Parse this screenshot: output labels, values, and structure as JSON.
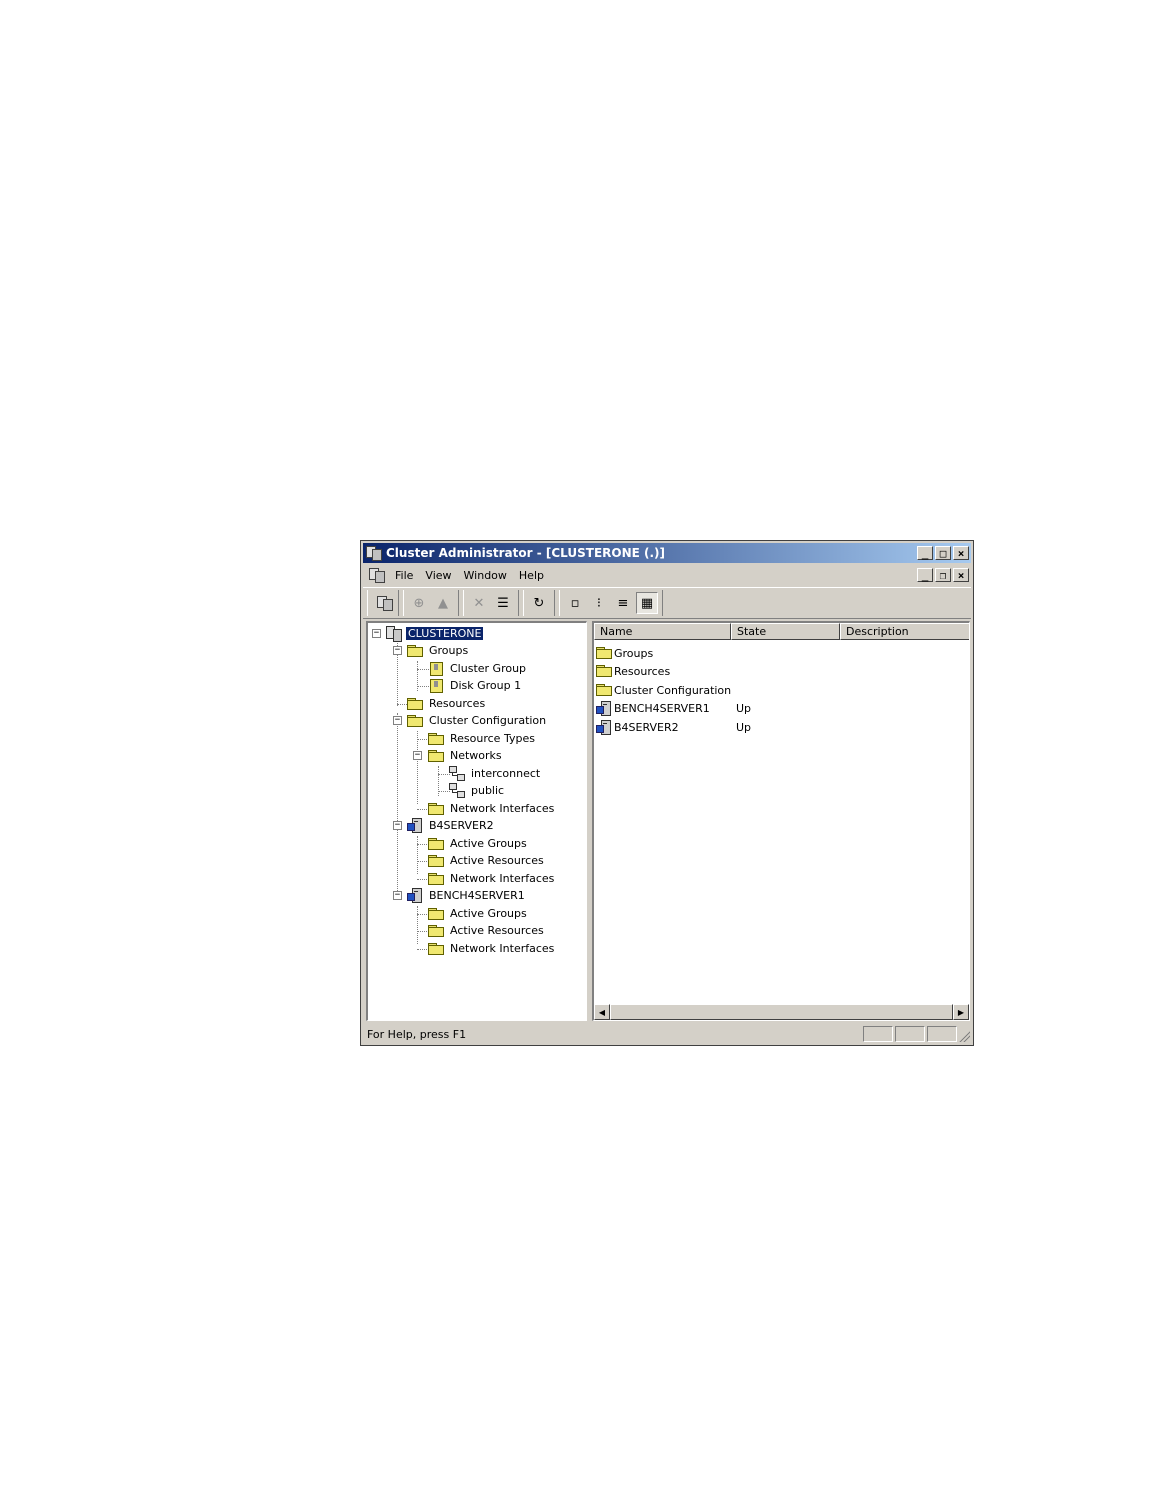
{
  "window": {
    "title": "Cluster Administrator - [CLUSTERONE (.)]",
    "caption_buttons": {
      "minimize": "_",
      "maximize": "□",
      "close": "×"
    },
    "child_caption_buttons": {
      "minimize": "_",
      "restore": "❐",
      "close": "×"
    }
  },
  "menu": [
    "File",
    "View",
    "Window",
    "Help"
  ],
  "toolbar": {
    "icons": [
      "open-connection-icon",
      "bring-online-icon",
      "take-offline-icon",
      "delete-icon",
      "properties-icon",
      "refresh-icon",
      "large-icons-icon",
      "small-icons-icon",
      "list-icon",
      "details-icon"
    ],
    "glyphs": {
      "bring_online": "⊕",
      "take_offline": "▲",
      "delete": "✕",
      "properties": "☰",
      "refresh": "↻",
      "large_icons": "▫",
      "small_icons": "⁝",
      "list": "≡",
      "details": "▦"
    }
  },
  "tree": [
    {
      "label": "CLUSTERONE",
      "icon": "cluster-icon",
      "selected": true
    },
    {
      "label": "Groups",
      "icon": "folder-icon"
    },
    {
      "label": "Cluster Group",
      "icon": "group-icon"
    },
    {
      "label": "Disk Group 1",
      "icon": "group-icon"
    },
    {
      "label": "Resources",
      "icon": "folder-icon"
    },
    {
      "label": "Cluster Configuration",
      "icon": "folder-icon"
    },
    {
      "label": "Resource Types",
      "icon": "folder-icon"
    },
    {
      "label": "Networks",
      "icon": "folder-icon"
    },
    {
      "label": "interconnect",
      "icon": "network-icon"
    },
    {
      "label": "public",
      "icon": "network-icon"
    },
    {
      "label": "Network Interfaces",
      "icon": "folder-icon"
    },
    {
      "label": "B4SERVER2",
      "icon": "server-icon"
    },
    {
      "label": "Active Groups",
      "icon": "folder-icon"
    },
    {
      "label": "Active Resources",
      "icon": "folder-icon"
    },
    {
      "label": "Network Interfaces",
      "icon": "folder-icon"
    },
    {
      "label": "BENCH4SERVER1",
      "icon": "server-icon"
    },
    {
      "label": "Active Groups",
      "icon": "folder-icon"
    },
    {
      "label": "Active Resources",
      "icon": "folder-icon"
    },
    {
      "label": "Network Interfaces",
      "icon": "folder-icon"
    }
  ],
  "tree_expander": {
    "collapse": "−"
  },
  "list": {
    "columns": [
      "Name",
      "State",
      "Description"
    ],
    "rows": [
      {
        "name": "Groups",
        "state": "",
        "icon": "folder-icon"
      },
      {
        "name": "Resources",
        "state": "",
        "icon": "folder-icon"
      },
      {
        "name": "Cluster Configuration",
        "state": "",
        "icon": "folder-icon"
      },
      {
        "name": "BENCH4SERVER1",
        "state": "Up",
        "icon": "server-icon"
      },
      {
        "name": "B4SERVER2",
        "state": "Up",
        "icon": "server-icon"
      }
    ]
  },
  "scrollbar": {
    "left_arrow": "◀",
    "right_arrow": "▶"
  },
  "status": {
    "text": "For Help, press F1"
  }
}
